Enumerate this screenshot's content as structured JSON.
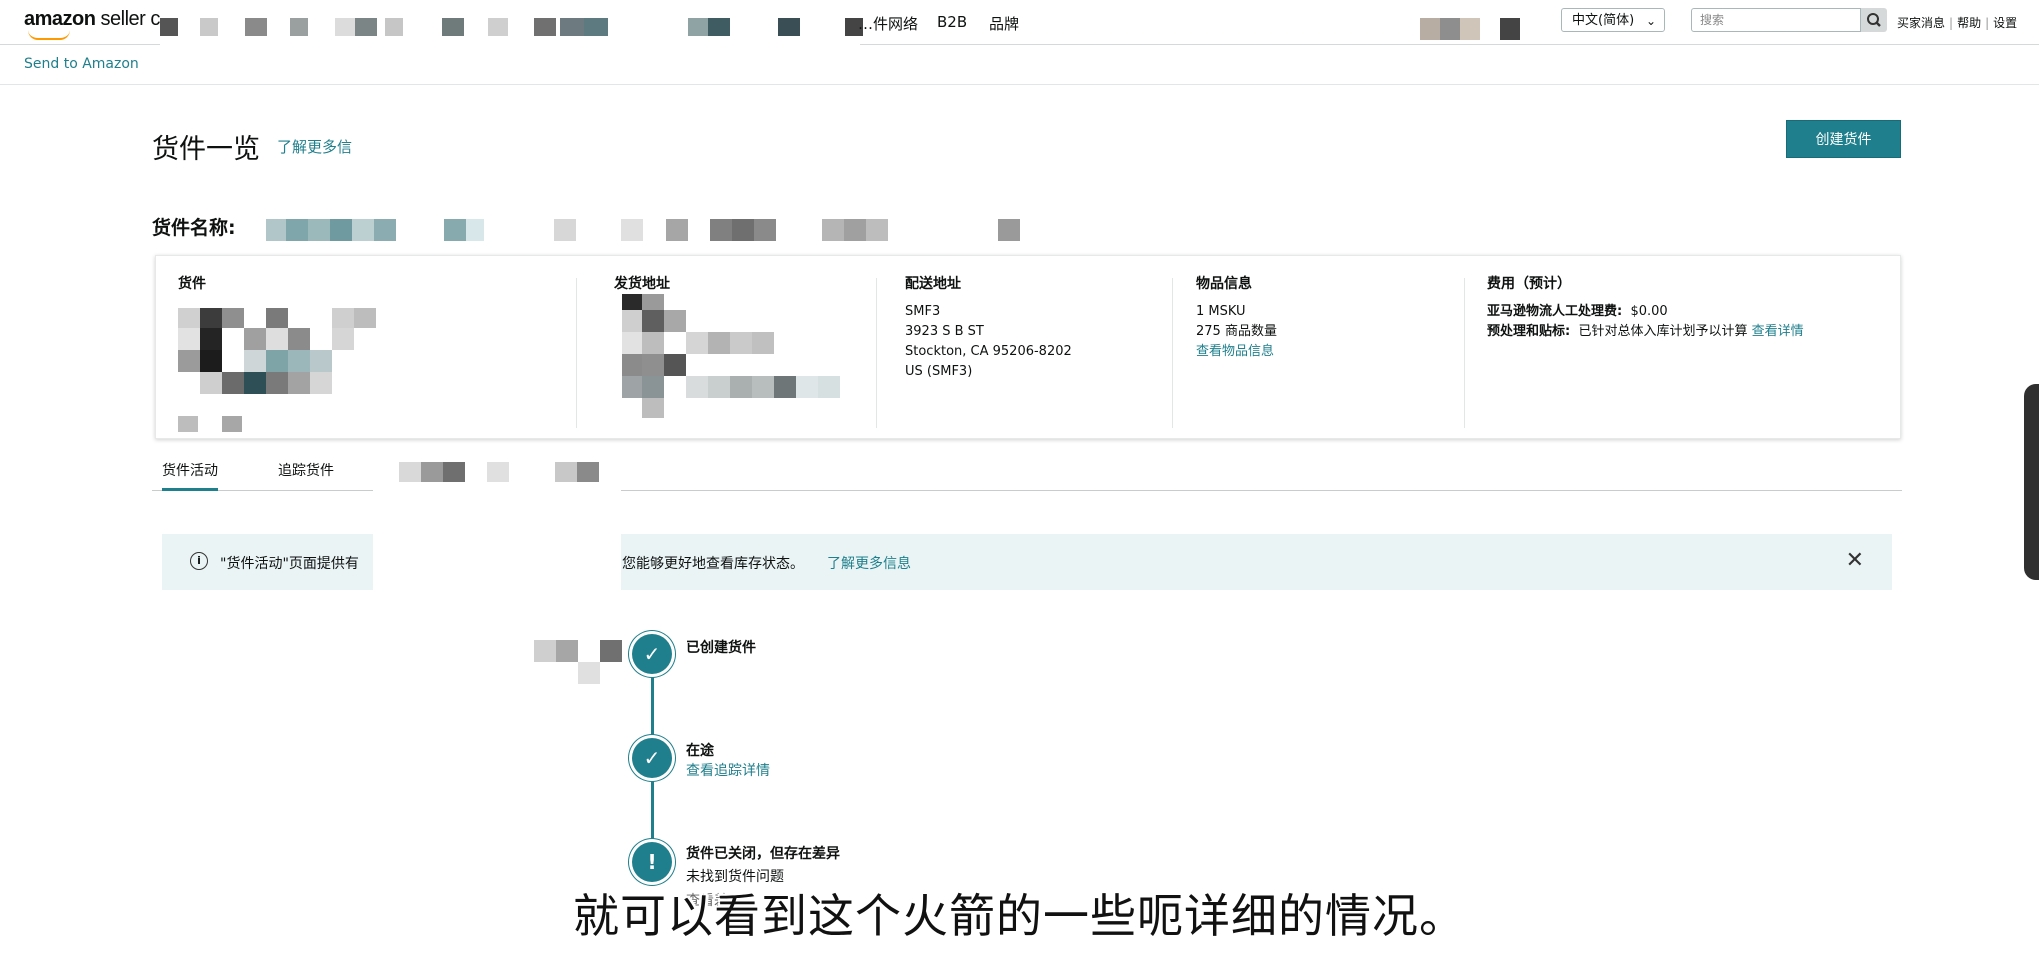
{
  "header": {
    "logo_main": "amazon",
    "logo_sub": " seller ce",
    "nav_items": [
      "…件网络",
      "B2B",
      "品牌"
    ],
    "language": "中文(简体)",
    "search_placeholder": "搜索",
    "top_links": [
      "买家消息",
      "帮助",
      "设置"
    ]
  },
  "subnav": {
    "send_to_amazon": "Send to Amazon"
  },
  "page": {
    "title": "货件一览",
    "learn_more": "了解更多信",
    "create_button": "创建货件",
    "shipment_name_label": "货件名称:"
  },
  "info_card": {
    "shipment": {
      "heading": "货件"
    },
    "ship_from": {
      "heading": "发货地址"
    },
    "ship_to": {
      "heading": "配送地址",
      "lines": [
        "SMF3",
        "3923 S B ST",
        "Stockton, CA 95206-8202",
        "US (SMF3)"
      ]
    },
    "items": {
      "heading": "物品信息",
      "msku": "1 MSKU",
      "quantity": "275 商品数量",
      "link": "查看物品信息"
    },
    "fees": {
      "heading": "费用（预计）",
      "fba_label": "亚马逊物流人工处理费:",
      "fba_value": "$0.00",
      "prep_label": "预处理和贴标:",
      "prep_value": "已针对总体入库计划予以计算",
      "prep_link": "查看详情"
    }
  },
  "tabs": [
    "货件活动",
    "追踪货件"
  ],
  "alert": {
    "text_before": "\"货件活动\"页面提供有",
    "text_after": "您能够更好地查看库存状态。",
    "link": "了解更多信息",
    "close": "✕"
  },
  "timeline": [
    {
      "title": "已创建货件",
      "sub": "",
      "icon": "check-icon",
      "glyph": "✓"
    },
    {
      "title": "在途",
      "sub": "查看追踪详情",
      "icon": "check-icon",
      "glyph": "✓"
    },
    {
      "title": "货件已关闭，但存在差异",
      "sub": "未找到货件问题",
      "icon": "alert-icon",
      "glyph": "!"
    }
  ],
  "timeline_faded": "查看差异",
  "caption": "就可以看到这个火箭的一些呃详细的情况。",
  "colors": {
    "accent": "#1f7f8c",
    "alert_bg": "#eaf4f5",
    "logo_smile": "#ff9900"
  }
}
